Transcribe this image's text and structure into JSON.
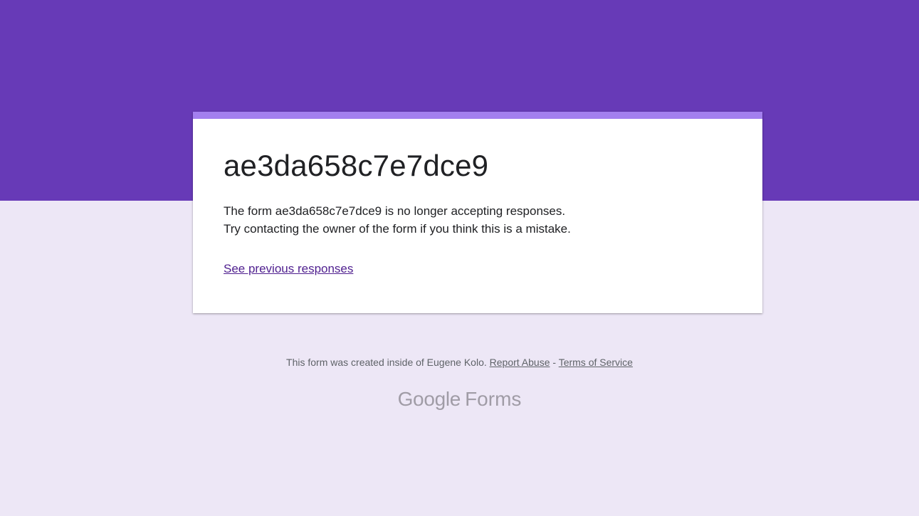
{
  "colors": {
    "header_band": "#673ab7",
    "page_background": "#ede7f6",
    "card_accent": "#a37fef",
    "link": "#4f1f8f"
  },
  "form": {
    "title": "ae3da658c7e7dce9",
    "message_line1": "The form ae3da658c7e7dce9 is no longer accepting responses.",
    "message_line2": "Try contacting the owner of the form if you think this is a mistake.",
    "previous_responses_link": "See previous responses"
  },
  "footer": {
    "created_text": "This form was created inside of Eugene Kolo.",
    "report_abuse_label": "Report Abuse",
    "separator": "-",
    "terms_label": "Terms of Service"
  },
  "branding": {
    "google": "Google",
    "product": "Forms"
  }
}
